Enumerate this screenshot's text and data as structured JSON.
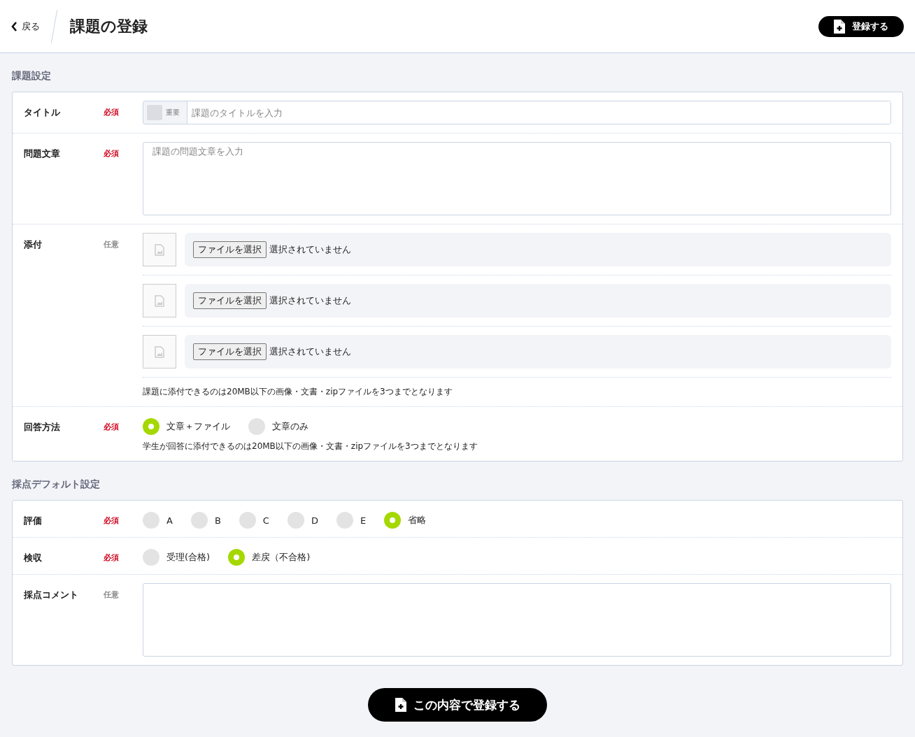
{
  "header": {
    "back": "戻る",
    "title": "課題の登録",
    "submit": "登録する"
  },
  "sections": [
    {
      "title": "課題設定",
      "rows": [
        {
          "kind": "text",
          "label": "タイトル",
          "badge": "必須",
          "required": true,
          "tag": {
            "label": "重要",
            "checked": false
          },
          "placeholder": "課題のタイトルを入力"
        },
        {
          "kind": "textarea",
          "label": "問題文章",
          "badge": "必須",
          "required": true,
          "placeholder": "課題の問題文章を入力"
        },
        {
          "kind": "files",
          "label": "添付",
          "badge": "任意",
          "required": false,
          "files": [
            {
              "button": "ファイルを選択",
              "status": "選択されていません"
            },
            {
              "button": "ファイルを選択",
              "status": "選択されていません"
            },
            {
              "button": "ファイルを選択",
              "status": "選択されていません"
            }
          ],
          "note": "課題に添付できるのは20MB以下の画像・文書・zipファイルを3つまでとなります"
        },
        {
          "kind": "radio",
          "label": "回答方法",
          "badge": "必須",
          "required": true,
          "options": [
            {
              "label": "文章＋ファイル",
              "selected": true
            },
            {
              "label": "文章のみ",
              "selected": false
            }
          ],
          "note": "学生が回答に添付できるのは20MB以下の画像・文書・zipファイルを3つまでとなります"
        }
      ]
    },
    {
      "title": "採点デフォルト設定",
      "rows": [
        {
          "kind": "radio",
          "label": "評価",
          "badge": "必須",
          "required": true,
          "options": [
            {
              "label": "A",
              "selected": false
            },
            {
              "label": "B",
              "selected": false
            },
            {
              "label": "C",
              "selected": false
            },
            {
              "label": "D",
              "selected": false
            },
            {
              "label": "E",
              "selected": false
            },
            {
              "label": "省略",
              "selected": true
            }
          ]
        },
        {
          "kind": "radio",
          "label": "検収",
          "badge": "必須",
          "required": true,
          "options": [
            {
              "label": "受理(合格)",
              "selected": false
            },
            {
              "label": "差戻（不合格)",
              "selected": true
            }
          ]
        },
        {
          "kind": "textarea",
          "label": "採点コメント",
          "badge": "任意",
          "required": false
        }
      ]
    }
  ],
  "footer": {
    "submit": "この内容で登録する"
  }
}
